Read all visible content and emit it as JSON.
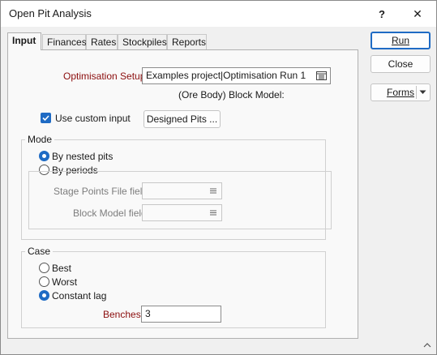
{
  "window": {
    "title": "Open Pit Analysis",
    "help_label": "?",
    "close_label": "✕"
  },
  "tabs": [
    {
      "label": "Input",
      "active": true
    },
    {
      "label": "Finances",
      "active": false
    },
    {
      "label": "Rates",
      "active": false
    },
    {
      "label": "Stockpiles",
      "active": false
    },
    {
      "label": "Reports",
      "active": false
    }
  ],
  "input": {
    "optimisation_setup_label": "Optimisation Setup",
    "optimisation_setup_value": "Examples project|Optimisation Run 1",
    "block_model_label": "(Ore Body) Block Model:",
    "use_custom_input_label": "Use custom input",
    "use_custom_input_checked": true,
    "designed_pits_button": "Designed Pits ..."
  },
  "mode": {
    "title": "Mode",
    "by_nested_pits_label": "By nested pits",
    "by_periods_label": "By periods",
    "selected": "By nested pits",
    "stage_points_label": "Stage Points File field",
    "stage_points_value": "",
    "block_model_field_label": "Block Model field",
    "block_model_field_value": ""
  },
  "case": {
    "title": "Case",
    "best_label": "Best",
    "worst_label": "Worst",
    "constant_lag_label": "Constant lag",
    "selected": "Constant lag",
    "benches_label": "Benches",
    "benches_value": "3"
  },
  "side_buttons": {
    "run": "Run",
    "close": "Close",
    "forms": "Forms"
  },
  "colors": {
    "accent": "#1f6bc4",
    "required_label": "#8b0d0d"
  }
}
